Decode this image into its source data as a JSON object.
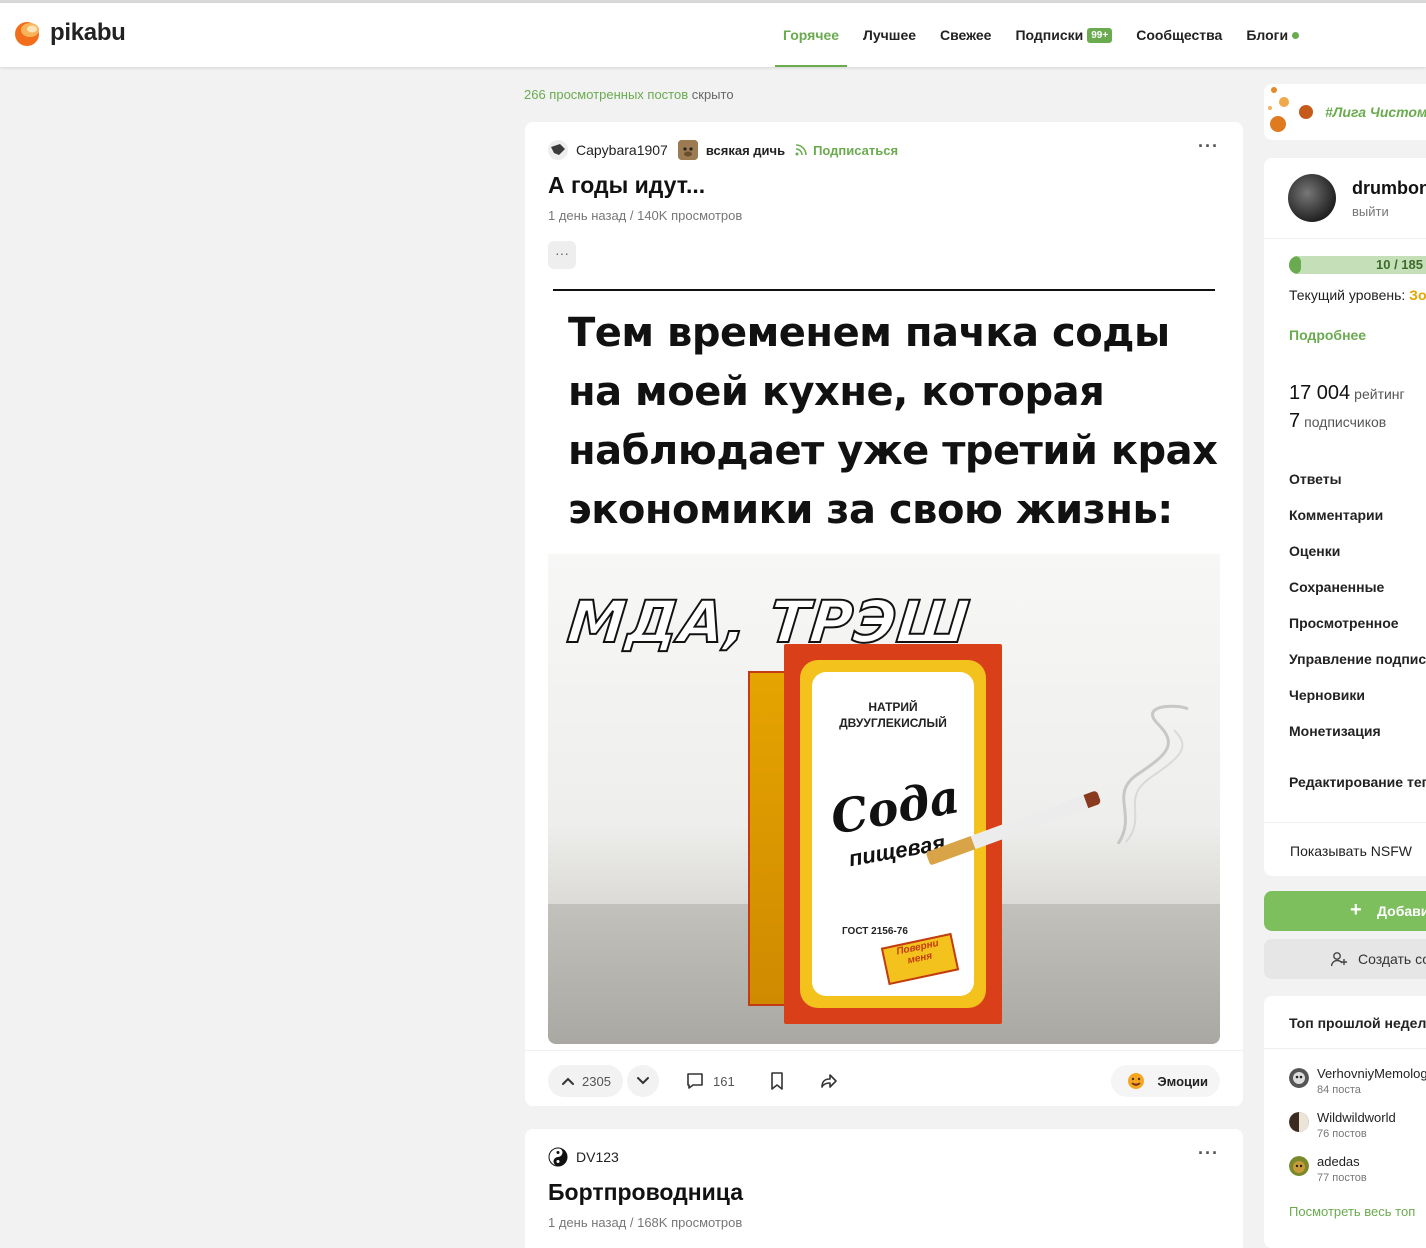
{
  "header": {
    "logo_text": "pikabu",
    "nav": [
      {
        "label": "Горячее",
        "active": true
      },
      {
        "label": "Лучшее"
      },
      {
        "label": "Свежее"
      },
      {
        "label": "Подписки",
        "badge": "99+"
      },
      {
        "label": "Сообщества"
      },
      {
        "label": "Блоги",
        "dot": true
      }
    ]
  },
  "feed": {
    "hidden_link": "266 просмотренных постов",
    "hidden_suffix": "скрыто",
    "posts": [
      {
        "author": "Capybara1907",
        "community": "всякая дичь",
        "subscribe": "Подписаться",
        "title": "А годы идут...",
        "meta": "1 день назад / 140K просмотров",
        "tags_more": "···",
        "image": {
          "caption_lines": [
            "Тем временем пачка соды",
            "на моей кухне, которая",
            "наблюдает уже третий крах",
            "экономики за свою жизнь:"
          ],
          "overlay_text": "МДА, ТРЭШ",
          "box_line1": "НАТРИЙ",
          "box_line2": "ДВУУГЛЕКИСЛЫЙ",
          "box_brand": "Сода",
          "box_sub": "пищевая",
          "box_gost": "ГОСТ 2156-76",
          "box_turn": "Поверни меня"
        },
        "votes": "2305",
        "comments": "161",
        "emotions": "Эмоции"
      },
      {
        "author": "DV123",
        "title": "Бортпроводница",
        "meta": "1 день назад / 168K просмотров"
      }
    ]
  },
  "sidebar": {
    "league": "#Лига Чистомэ",
    "profile": {
      "name": "drumbone",
      "exit": "выйти",
      "progress_text": "10 / 185",
      "progress_fraction": 0.054,
      "level_label": "Текущий уровень:",
      "level_value": "Зо",
      "more": "Подробнее",
      "rating_value": "17 004",
      "rating_label": "рейтинг",
      "subs_value": "7",
      "subs_label": "подписчиков",
      "menu": [
        "Ответы",
        "Комментарии",
        "Оценки",
        "Сохраненные",
        "Просмотренное",
        "Управление подписк",
        "Черновики",
        "Монетизация"
      ],
      "edit_tags": "Редактирование тегс",
      "nsfw": "Показывать NSFW"
    },
    "add_button": "Добави",
    "create_button": "Создать со",
    "top": {
      "title": "Топ прошлой недели",
      "items": [
        {
          "name": "VerhovniyMemolog",
          "count": "84 поста"
        },
        {
          "name": "Wildwildworld",
          "count": "76 постов"
        },
        {
          "name": "adedas",
          "count": "77 постов"
        }
      ],
      "all_link": "Посмотреть весь топ"
    }
  },
  "colors": {
    "accent": "#6aab4f",
    "gold": "#e3a500",
    "logo_orange": "#f26e1a"
  }
}
